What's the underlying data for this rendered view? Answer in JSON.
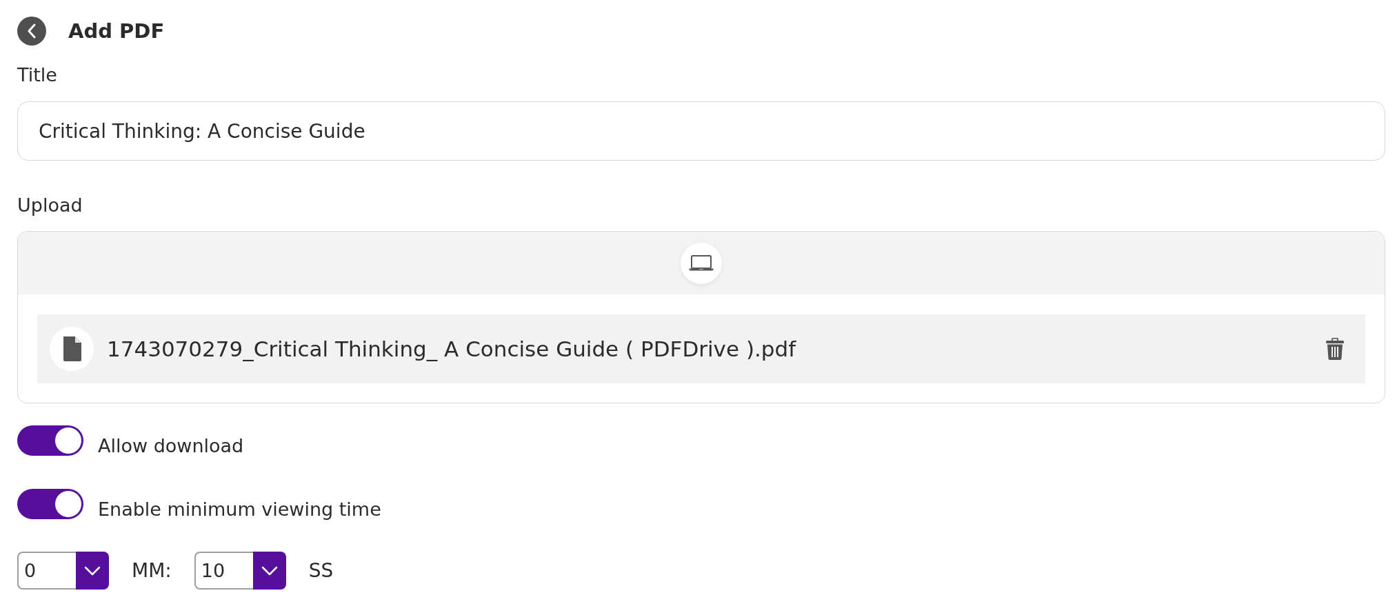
{
  "header": {
    "title": "Add PDF"
  },
  "title_field": {
    "label": "Title",
    "value": "Critical Thinking: A Concise Guide"
  },
  "upload": {
    "label": "Upload",
    "files": [
      {
        "name": "1743070279_Critical Thinking_ A Concise Guide ( PDFDrive ).pdf"
      }
    ]
  },
  "toggles": [
    {
      "label": "Allow download",
      "on": true
    },
    {
      "label": "Enable minimum viewing time",
      "on": true
    }
  ],
  "viewing_time": [
    {
      "value": "0",
      "unit": "MM:"
    },
    {
      "value": "10",
      "unit": "SS"
    }
  ]
}
